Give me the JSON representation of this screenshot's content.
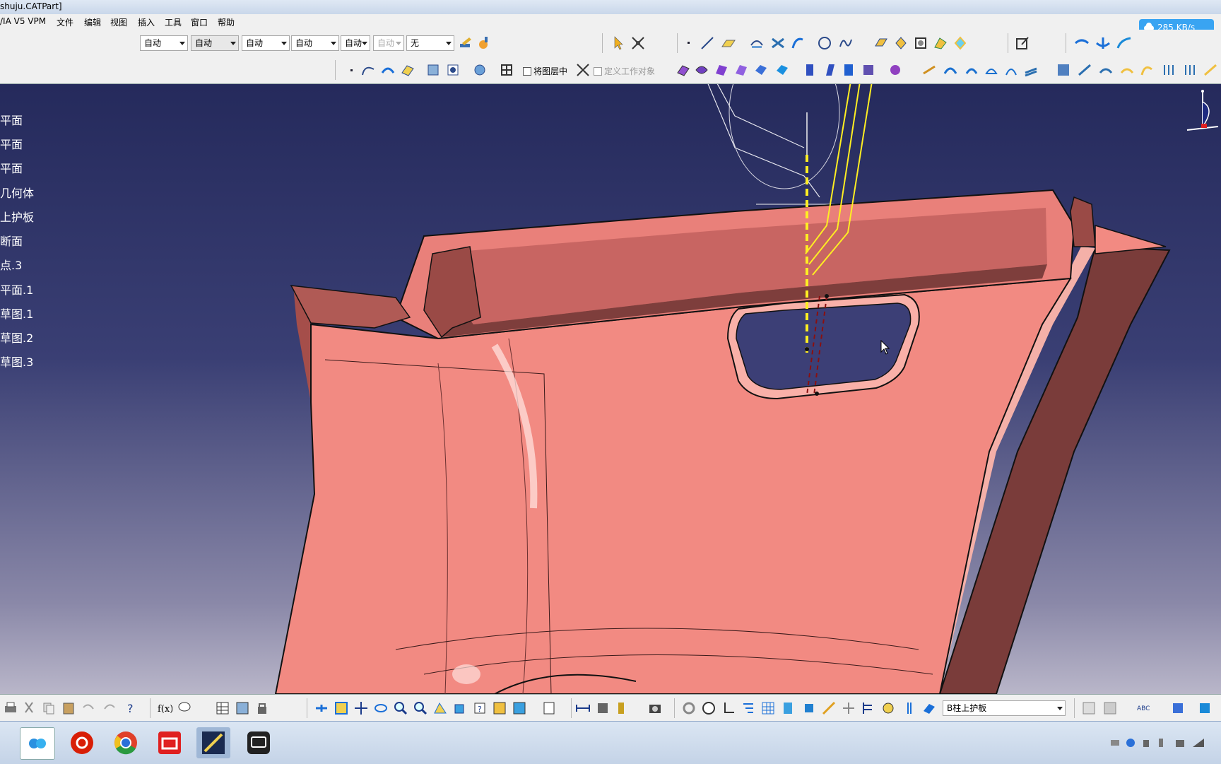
{
  "window": {
    "title": "shuju.CATPart]"
  },
  "menu": {
    "items": [
      "/IA V5 VPM",
      "文件",
      "编辑",
      "视图",
      "插入",
      "工具",
      "窗口",
      "帮助"
    ]
  },
  "net_speed": {
    "text": "285 KB/s"
  },
  "toolbar": {
    "combos": [
      {
        "value": "自动"
      },
      {
        "value": "自动"
      },
      {
        "value": "自动"
      },
      {
        "value": "自动"
      },
      {
        "value": "自动"
      },
      {
        "value": "自动"
      },
      {
        "value": "无"
      }
    ],
    "checkbox_layer": "将图层中",
    "checkbox_work": "定义工作对象"
  },
  "tree": {
    "items": [
      "平面",
      "平面",
      "平面",
      "几何体",
      "上护板",
      "断面",
      "点.3",
      "平面.1",
      "草图.1",
      "草图.2",
      "草图.3",
      ""
    ]
  },
  "bottom_toolbar": {
    "current_body": "B柱上护板"
  },
  "colors": {
    "viewport_top": "#252a5c",
    "part_surface": "#f08078",
    "accent": "#39a4f2"
  }
}
